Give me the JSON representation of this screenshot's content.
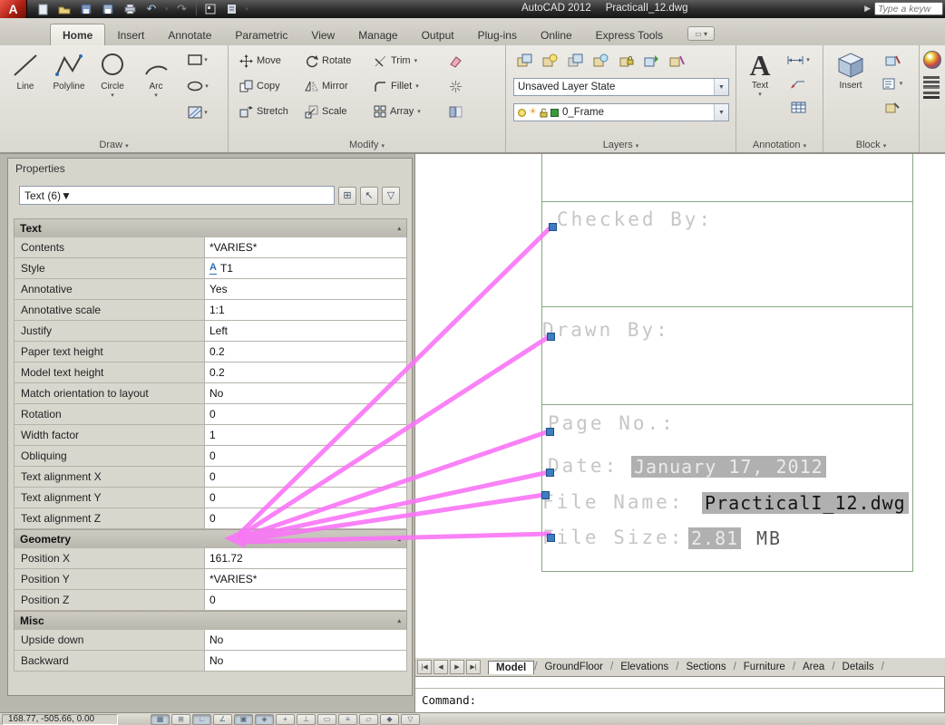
{
  "colors": {
    "selection_pink": "#fa75f7",
    "grip_blue": "#3e7dc0",
    "frame_green": "#85a97f",
    "highlight_gray": "#b0b0b0"
  },
  "titlebar": {
    "app_name": "AutoCAD 2012",
    "document": "PracticalI_12.dwg",
    "search_placeholder": "Type a keyw"
  },
  "ribbon": {
    "tabs": [
      "Home",
      "Insert",
      "Annotate",
      "Parametric",
      "View",
      "Manage",
      "Output",
      "Plug-ins",
      "Online",
      "Express Tools"
    ],
    "active_tab": "Home",
    "panels": {
      "draw": {
        "label": "Draw",
        "tools": [
          "Line",
          "Polyline",
          "Circle",
          "Arc"
        ]
      },
      "modify": {
        "label": "Modify",
        "tools": [
          "Move",
          "Rotate",
          "Trim",
          "Copy",
          "Mirror",
          "Fillet",
          "Stretch",
          "Scale",
          "Array"
        ]
      },
      "layers": {
        "label": "Layers",
        "layer_state": "Unsaved Layer State",
        "current_layer": "0_Frame"
      },
      "annotation": {
        "label": "Annotation",
        "text_tool": "Text"
      },
      "block": {
        "label": "Block",
        "insert_tool": "Insert"
      }
    }
  },
  "properties": {
    "title": "Properties",
    "selection": "Text (6)",
    "sections": [
      {
        "name": "Text",
        "rows": [
          {
            "label": "Contents",
            "value": "*VARIES*"
          },
          {
            "label": "Style",
            "value": "T1"
          },
          {
            "label": "Annotative",
            "value": "Yes"
          },
          {
            "label": "Annotative scale",
            "value": "1:1"
          },
          {
            "label": "Justify",
            "value": "Left"
          },
          {
            "label": "Paper text height",
            "value": "0.2"
          },
          {
            "label": "Model text height",
            "value": "0.2"
          },
          {
            "label": "Match orientation to layout",
            "value": "No"
          },
          {
            "label": "Rotation",
            "value": "0"
          },
          {
            "label": "Width factor",
            "value": "1"
          },
          {
            "label": "Obliquing",
            "value": "0"
          },
          {
            "label": "Text alignment X",
            "value": "0"
          },
          {
            "label": "Text alignment Y",
            "value": "0"
          },
          {
            "label": "Text alignment Z",
            "value": "0"
          }
        ]
      },
      {
        "name": "Geometry",
        "rows": [
          {
            "label": "Position X",
            "value": "161.72"
          },
          {
            "label": "Position Y",
            "value": "*VARIES*"
          },
          {
            "label": "Position Z",
            "value": "0"
          }
        ]
      },
      {
        "name": "Misc",
        "rows": [
          {
            "label": "Upside down",
            "value": "No"
          },
          {
            "label": "Backward",
            "value": "No"
          }
        ]
      }
    ]
  },
  "drawing": {
    "annotations": [
      {
        "label": "Checked By:"
      },
      {
        "label": "Drawn By:"
      },
      {
        "label": "Page No.:"
      },
      {
        "label": "Date:",
        "value": "January 17, 2012"
      },
      {
        "label": "File Name:",
        "value": "PracticalI_12.dwg"
      },
      {
        "label": "File Size:",
        "value": "2.81",
        "suffix": "MB"
      }
    ]
  },
  "layout": {
    "tabs": [
      "Model",
      "GroundFloor",
      "Elevations",
      "Sections",
      "Furniture",
      "Area",
      "Details"
    ],
    "active_tab": "Model"
  },
  "command_line": {
    "prompt": "Command:"
  },
  "status_bar": {
    "coordinates": "168.77, -505.66, 0.00"
  }
}
